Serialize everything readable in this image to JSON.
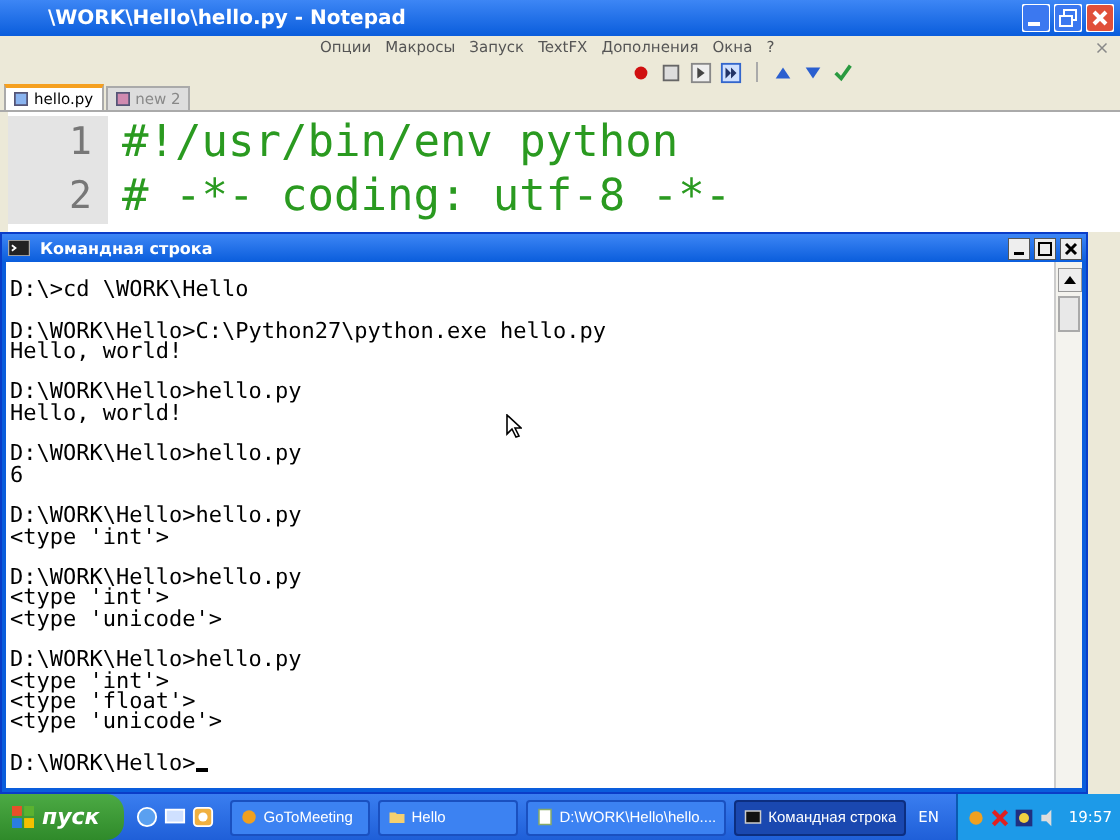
{
  "editor_window": {
    "title": "\\WORK\\Hello\\hello.py - Notepad",
    "menu": [
      "Опции",
      "Макросы",
      "Запуск",
      "TextFX",
      "Дополнения",
      "Окна",
      "?"
    ],
    "tabs": [
      {
        "label": "hello.py",
        "selected": true
      },
      {
        "label": "new 2",
        "selected": false
      }
    ],
    "lines": [
      {
        "number": "1",
        "code": "#!/usr/bin/env python"
      },
      {
        "number": "2",
        "code": "# -*- coding: utf-8 -*-"
      }
    ]
  },
  "console_window": {
    "title": "Командная строка",
    "blocks": [
      [
        "D:\\>cd \\WORK\\Hello"
      ],
      [
        "D:\\WORK\\Hello>C:\\Python27\\python.exe hello.py",
        "Hello, world!"
      ],
      [
        "D:\\WORK\\Hello>hello.py",
        "Hello, world!"
      ],
      [
        "D:\\WORK\\Hello>hello.py",
        "6"
      ],
      [
        "D:\\WORK\\Hello>hello.py",
        "<type 'int'>"
      ],
      [
        "D:\\WORK\\Hello>hello.py",
        "<type 'int'>",
        "<type 'unicode'>"
      ],
      [
        "D:\\WORK\\Hello>hello.py",
        "<type 'int'>",
        "<type 'float'>",
        "<type 'unicode'>"
      ],
      [
        "D:\\WORK\\Hello>"
      ]
    ]
  },
  "taskbar": {
    "start": "пуск",
    "items": [
      {
        "label": "GoToMeeting",
        "kind": "app",
        "selected": false
      },
      {
        "label": "Hello",
        "kind": "folder",
        "selected": false
      },
      {
        "label": "D:\\WORK\\Hello\\hello....",
        "kind": "editor",
        "selected": false
      },
      {
        "label": "Командная строка",
        "kind": "console",
        "selected": true
      }
    ],
    "language": "EN",
    "clock": "19:57"
  }
}
